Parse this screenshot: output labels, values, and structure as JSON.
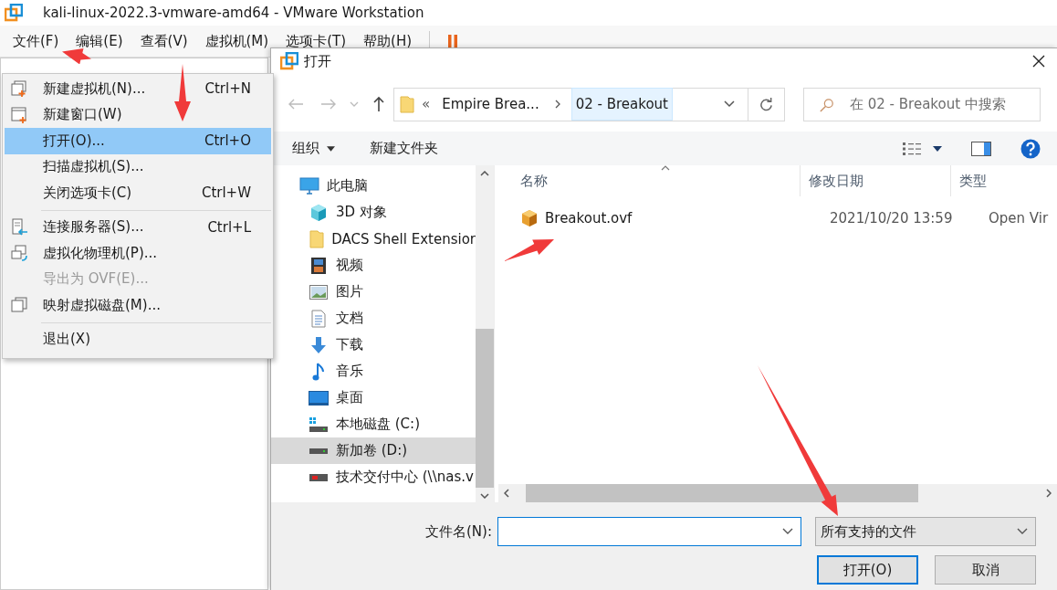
{
  "window": {
    "title": "kali-linux-2022.3-vmware-amd64 - VMware Workstation"
  },
  "menu_bar": [
    "文件(F)",
    "编辑(E)",
    "查看(V)",
    "虚拟机(M)",
    "选项卡(T)",
    "帮助(H)"
  ],
  "file_menu": [
    {
      "kind": "item",
      "label": "新建虚拟机(N)...",
      "shortcut": "Ctrl+N",
      "selected": false,
      "disabled": false
    },
    {
      "kind": "item",
      "label": "新建窗口(W)",
      "selected": false,
      "disabled": false
    },
    {
      "kind": "item",
      "label": "打开(O)...",
      "shortcut": "Ctrl+O",
      "selected": true,
      "disabled": false
    },
    {
      "kind": "item",
      "label": "扫描虚拟机(S)...",
      "selected": false,
      "disabled": false
    },
    {
      "kind": "item",
      "label": "关闭选项卡(C)",
      "shortcut": "Ctrl+W",
      "selected": false,
      "disabled": false
    },
    {
      "kind": "separator"
    },
    {
      "kind": "item",
      "label": "连接服务器(S)...",
      "shortcut": "Ctrl+L",
      "selected": false,
      "disabled": false
    },
    {
      "kind": "item",
      "label": "虚拟化物理机(P)...",
      "selected": false,
      "disabled": false
    },
    {
      "kind": "item",
      "label": "导出为 OVF(E)...",
      "selected": false,
      "disabled": true
    },
    {
      "kind": "item",
      "label": "映射虚拟磁盘(M)...",
      "selected": false,
      "disabled": false
    },
    {
      "kind": "separator"
    },
    {
      "kind": "item",
      "label": "退出(X)",
      "selected": false,
      "disabled": false
    }
  ],
  "dialog": {
    "title": "打开",
    "address": {
      "prefix": "«",
      "crumbs": [
        {
          "label": "Empire Brea...",
          "selected": false
        },
        {
          "label": "02 - Breakout",
          "selected": true
        }
      ]
    },
    "search": {
      "placeholder": "在 02 - Breakout 中搜索"
    },
    "toolbar": {
      "organize": "组织",
      "new_folder": "新建文件夹"
    },
    "nav": [
      {
        "label": "此电脑",
        "selected": false,
        "children": [
          {
            "label": "3D 对象",
            "selected": false
          },
          {
            "label": "DACS Shell Extensior",
            "selected": false
          },
          {
            "label": "视频",
            "selected": false
          },
          {
            "label": "图片",
            "selected": false
          },
          {
            "label": "文档",
            "selected": false
          },
          {
            "label": "下载",
            "selected": false
          },
          {
            "label": "音乐",
            "selected": false
          },
          {
            "label": "桌面",
            "selected": false
          },
          {
            "label": "本地磁盘 (C:)",
            "selected": false
          },
          {
            "label": "新加卷 (D:)",
            "selected": true
          },
          {
            "label": "技术交付中心 (\\\\nas.v",
            "selected": false
          }
        ]
      }
    ],
    "columns": [
      "名称",
      "修改日期",
      "类型"
    ],
    "rows": [
      {
        "name": "Breakout.ovf",
        "modified": "2021/10/20 13:59",
        "type": "Open Vir"
      }
    ],
    "file_name": {
      "label": "文件名(N):"
    },
    "filter": {
      "value": "所有支持的文件"
    },
    "buttons": [
      {
        "label": "打开(O)",
        "default": true
      },
      {
        "label": "取消",
        "default": false
      }
    ]
  }
}
